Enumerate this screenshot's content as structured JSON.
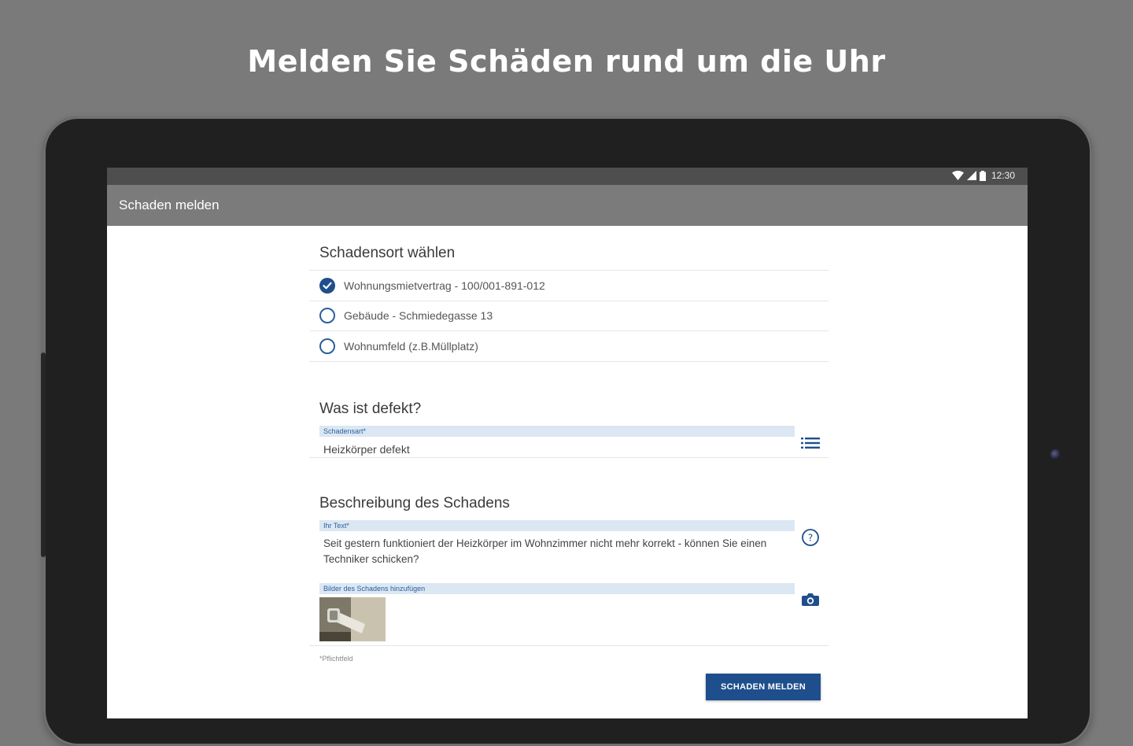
{
  "promo": {
    "heading": "Melden Sie Schäden rund um die Uhr"
  },
  "status_bar": {
    "time": "12:30",
    "icons": [
      "wifi-icon",
      "signal-icon",
      "battery-icon"
    ]
  },
  "toolbar": {
    "title": "Schaden melden"
  },
  "location": {
    "title": "Schadensort wählen",
    "options": [
      {
        "label": "Wohnungsmietvertrag - 100/001-891-012",
        "selected": true
      },
      {
        "label": "Gebäude - Schmiedegasse 13",
        "selected": false
      },
      {
        "label": "Wohnumfeld (z.B.Müllplatz)",
        "selected": false
      }
    ]
  },
  "defect": {
    "title": "Was ist defekt?",
    "field_label": "Schadensart*",
    "field_value": "Heizkörper defekt",
    "icon": "list-icon"
  },
  "description": {
    "title": "Beschreibung des Schadens",
    "text_label": "Ihr Text*",
    "text_value": "Seit gestern funktioniert der Heizkörper im Wohnzimmer nicht mehr korrekt - können Sie einen Techniker schicken?",
    "text_icon": "help-icon",
    "images_label": "Bilder des Schadens hinzufügen",
    "images_icon": "camera-icon"
  },
  "required_note": "*Pflichtfeld",
  "submit_label": "Schaden melden",
  "colors": {
    "accent": "#1f4e8c",
    "toolbar": "#7b7b7b",
    "status_bar": "#4e4e4e",
    "background": "#7a7a7a"
  }
}
